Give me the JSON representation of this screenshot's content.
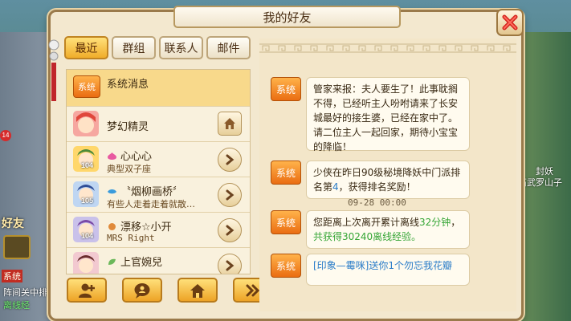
{
  "title": "我的好友",
  "tabs": [
    {
      "label": "最近",
      "active": true
    },
    {
      "label": "群组",
      "active": false
    },
    {
      "label": "联系人",
      "active": false
    },
    {
      "label": "邮件",
      "active": false
    }
  ],
  "system_badge": "系统",
  "list": [
    {
      "kind": "system",
      "name": "系统消息"
    },
    {
      "kind": "npc",
      "name": "梦幻精灵",
      "action": "home-icon"
    },
    {
      "kind": "friend",
      "name": "心心心",
      "status": "典型双子座",
      "level": "104",
      "zodiac_color": "#e85aa0",
      "action": "arrow-right-icon"
    },
    {
      "kind": "friend",
      "name": "〝烟柳画桥〞",
      "status": "有些人走着走着就散…",
      "level": "105",
      "zodiac_color": "#3a9bdc",
      "action": "arrow-right-icon"
    },
    {
      "kind": "friend",
      "name": "漂移☆小开",
      "status": "MRS Right",
      "level": "104",
      "zodiac_color": "#e08a3a",
      "action": "arrow-right-icon"
    },
    {
      "kind": "friend",
      "name": "上官婉兒",
      "status": "",
      "level": "",
      "zodiac_color": "#6bb85a",
      "action": "arrow-right-icon"
    }
  ],
  "messages": [
    {
      "sender": "系统",
      "text": "管家来报：夫人要生了！此事耽搁不得，已经听主人吩咐请来了长安城最好的接生婆，已经在家中了。请二位主人一起回家，期待小宝宝的降临！"
    },
    {
      "sender": "系统",
      "parts": [
        "少侠在昨日90级秘境降妖中门派排名第",
        "4",
        "，获得排名奖励！"
      ]
    },
    {
      "timestamp": "09-28 00:00"
    },
    {
      "sender": "系统",
      "parts": [
        "您距离上次离开累计离线",
        "32分钟",
        "，",
        "共获得30240离线经验。"
      ]
    },
    {
      "sender": "系统",
      "parts": [
        "[印象—霉咪]送你1个勿忘我花瓣"
      ]
    }
  ],
  "bottom_buttons": [
    "add-friend-icon",
    "chat-icon",
    "home-icon",
    "double-arrow-icon"
  ],
  "background": {
    "badge_count": "14",
    "friend_label": "好友",
    "chat_tag": "系统",
    "chat_line1": "阵间关中排",
    "chat_line2": "离线经",
    "right_label1": "封妖",
    "right_label2": "石武罗山子"
  },
  "colors": {
    "accent": "#f0ad2a",
    "panel": "#f3e8cf",
    "system": "#ea6d12",
    "highlight_blue": "#2a7cc8",
    "highlight_green": "#34a534"
  }
}
